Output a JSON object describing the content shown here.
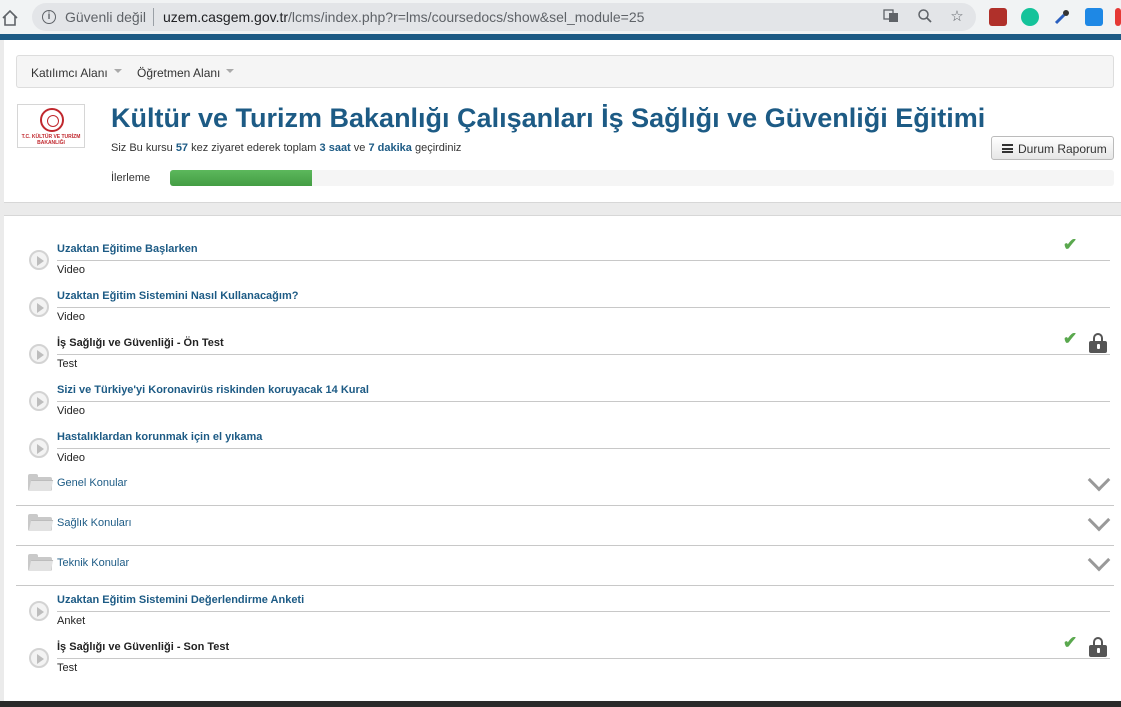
{
  "browser": {
    "security_label": "Güvenli değil",
    "url_domain": "uzem.casgem.gov.tr",
    "url_path": "/lcms/index.php?r=lms/coursedocs/show&sel_module=25"
  },
  "nav": {
    "participant": "Katılımcı Alanı",
    "teacher": "Öğretmen Alanı"
  },
  "logo": {
    "text": "T.C. KÜLTÜR VE TURİZM BAKANLIĞI"
  },
  "course": {
    "title": "Kültür ve Turizm Bakanlığı Çalışanları İş Sağlığı ve Güvenliği Eğitimi",
    "visit_prefix": "Siz Bu kursu",
    "visit_count": "57",
    "visit_mid": "kez ziyaret ederek toplam",
    "hours": "3 saat",
    "and": "ve",
    "minutes": "7 dakika",
    "visit_suffix": "geçirdiniz",
    "report_button": "Durum Raporum",
    "progress_label": "İlerleme",
    "progress_fraction": 0.15
  },
  "items": [
    {
      "title": "Uzaktan Eğitime Başlarken",
      "type": "Video",
      "done": true,
      "locked": false,
      "dark": false
    },
    {
      "title": "Uzaktan Eğitim Sistemini Nasıl Kullanacağım?",
      "type": "Video",
      "done": false,
      "locked": false,
      "dark": false
    },
    {
      "title": "İş Sağlığı ve Güvenliği - Ön Test",
      "type": "Test",
      "done": true,
      "locked": true,
      "dark": true
    },
    {
      "title": "Sizi ve Türkiye'yi Koronavirüs riskinden koruyacak 14 Kural",
      "type": "Video",
      "done": false,
      "locked": false,
      "dark": false
    },
    {
      "title": "Hastalıklardan korunmak için el yıkama",
      "type": "Video",
      "done": false,
      "locked": false,
      "dark": false
    }
  ],
  "folders": [
    {
      "label": "Genel Konular"
    },
    {
      "label": "Sağlık Konuları"
    },
    {
      "label": "Teknik Konular"
    }
  ],
  "items_after": [
    {
      "title": "Uzaktan Eğitim Sistemini Değerlendirme Anketi",
      "type": "Anket",
      "done": false,
      "locked": false,
      "dark": false
    },
    {
      "title": "İş Sağlığı ve Güvenliği - Son Test",
      "type": "Test",
      "done": true,
      "locked": true,
      "dark": true
    }
  ],
  "colors": {
    "brand": "#1d5b85",
    "progress": "#5cb85c",
    "check": "#5aa84e"
  }
}
